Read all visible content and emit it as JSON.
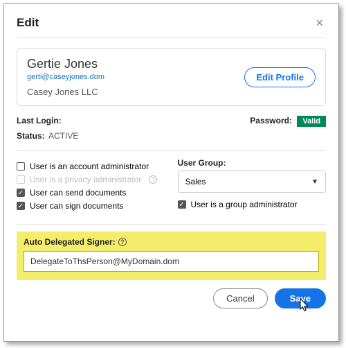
{
  "modal": {
    "title": "Edit",
    "close_glyph": "×"
  },
  "profile": {
    "name": "Gertie Jones",
    "email": "gerti@caseyjones.dom",
    "company": "Casey Jones LLC",
    "edit_label": "Edit Profile"
  },
  "meta": {
    "last_login_label": "Last Login:",
    "last_login_value": "",
    "password_label": "Password:",
    "password_badge": "Valid",
    "status_label": "Status:",
    "status_value": "ACTIVE"
  },
  "perms": {
    "account_admin": "User is an account administrator",
    "privacy_admin": "User is a privacy administrator",
    "can_send": "User can send documents",
    "can_sign": "User can sign documents",
    "group_admin": "User is a group administrator",
    "help_glyph": "?"
  },
  "user_group": {
    "label": "User Group:",
    "selected": "Sales",
    "caret_glyph": "▼"
  },
  "delegate": {
    "label": "Auto Delegated Signer:",
    "help_glyph": "?",
    "value": "DelegateToThsPerson@MyDomain.dom"
  },
  "footer": {
    "cancel": "Cancel",
    "save": "Save"
  },
  "check_glyph": "✓"
}
